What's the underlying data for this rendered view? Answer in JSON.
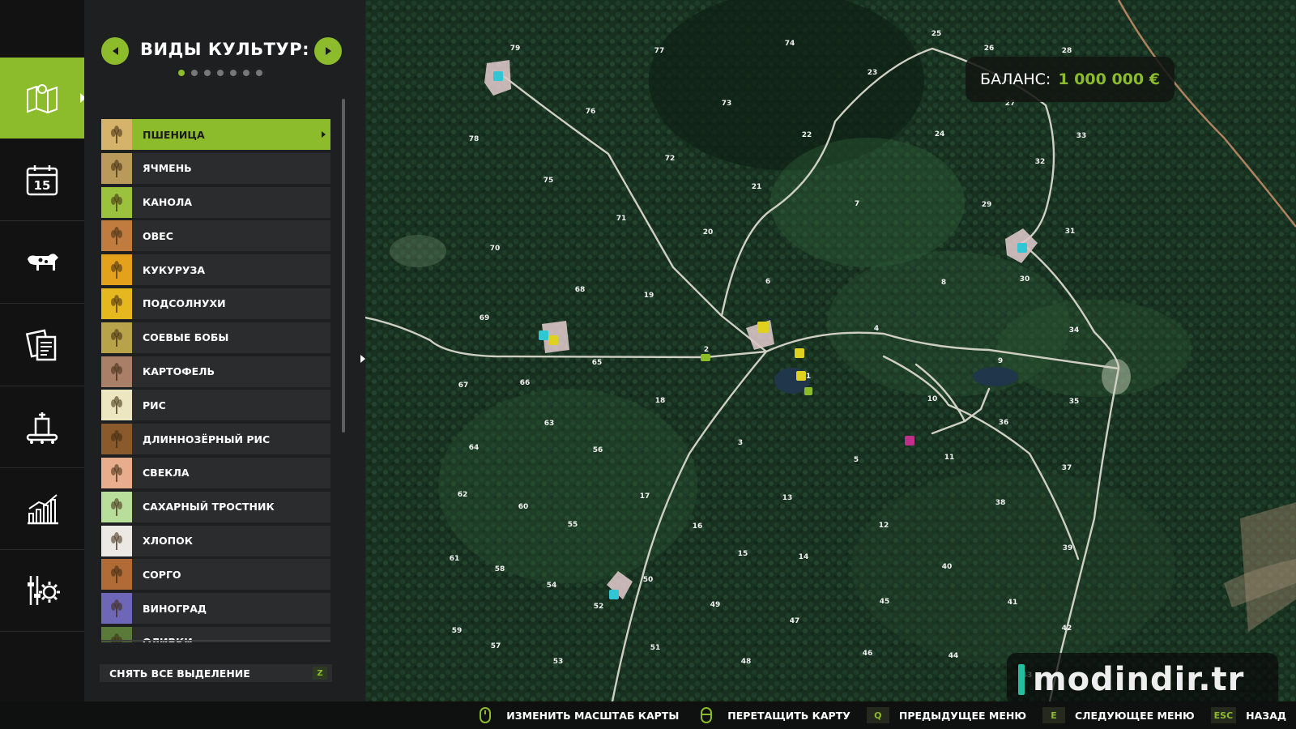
{
  "nav": {
    "items": [
      {
        "name": "map",
        "icon": "map-icon",
        "active": true
      },
      {
        "name": "calendar",
        "icon": "calendar-icon",
        "active": false,
        "day": "15"
      },
      {
        "name": "animals",
        "icon": "cow-icon",
        "active": false
      },
      {
        "name": "contracts",
        "icon": "documents-icon",
        "active": false
      },
      {
        "name": "production",
        "icon": "factory-icon",
        "active": false
      },
      {
        "name": "statistics",
        "icon": "chart-icon",
        "active": false
      },
      {
        "name": "settings",
        "icon": "gear-icon",
        "active": false
      }
    ]
  },
  "panel": {
    "title": "ВИДЫ КУЛЬТУР:",
    "page_count": 7,
    "current_page": 1,
    "crops": [
      {
        "label": "ПШЕНИЦА",
        "color": "#d6b36a",
        "selected": true
      },
      {
        "label": "ЯЧМЕНЬ",
        "color": "#b99a5b"
      },
      {
        "label": "КАНОЛА",
        "color": "#9bc23c"
      },
      {
        "label": "ОВЕС",
        "color": "#c07c3f"
      },
      {
        "label": "КУКУРУЗА",
        "color": "#e4a21c"
      },
      {
        "label": "ПОДСОЛНУХИ",
        "color": "#e6b81f"
      },
      {
        "label": "СОЕВЫЕ БОБЫ",
        "color": "#b8a24a"
      },
      {
        "label": "КАРТОФЕЛЬ",
        "color": "#a98067"
      },
      {
        "label": "РИС",
        "color": "#ece7c0"
      },
      {
        "label": "ДЛИННОЗЁРНЫЙ РИС",
        "color": "#8a5a2c"
      },
      {
        "label": "СВЕКЛА",
        "color": "#e7ad8c"
      },
      {
        "label": "САХАРНЫЙ ТРОСТНИК",
        "color": "#b9dd9b"
      },
      {
        "label": "ХЛОПОК",
        "color": "#ece9e4"
      },
      {
        "label": "СОРГО",
        "color": "#b06b36"
      },
      {
        "label": "ВИНОГРАД",
        "color": "#6e66b6"
      },
      {
        "label": "ОЛИВКИ",
        "color": "#5a7a3a"
      }
    ],
    "clear_label": "СНЯТЬ ВСЕ ВЫДЕЛЕНИЕ",
    "clear_key": "Z"
  },
  "balance": {
    "label": "БАЛАНС:",
    "value": "1 000 000 €"
  },
  "watermark": "modindir.tr",
  "map": {
    "field_numbers": [
      {
        "n": "79"
      },
      {
        "n": "77"
      },
      {
        "n": "74"
      },
      {
        "n": "25"
      },
      {
        "n": "26"
      },
      {
        "n": "28"
      },
      {
        "n": "23"
      },
      {
        "n": "27"
      },
      {
        "n": "76"
      },
      {
        "n": "73"
      },
      {
        "n": "78"
      },
      {
        "n": "72"
      },
      {
        "n": "22"
      },
      {
        "n": "24"
      },
      {
        "n": "33"
      },
      {
        "n": "32"
      },
      {
        "n": "75"
      },
      {
        "n": "21"
      },
      {
        "n": "7"
      },
      {
        "n": "29"
      },
      {
        "n": "71"
      },
      {
        "n": "20"
      },
      {
        "n": "31"
      },
      {
        "n": "70"
      },
      {
        "n": "6"
      },
      {
        "n": "8"
      },
      {
        "n": "30"
      },
      {
        "n": "68"
      },
      {
        "n": "19"
      },
      {
        "n": "69"
      },
      {
        "n": "4"
      },
      {
        "n": "34"
      },
      {
        "n": "2"
      },
      {
        "n": "9"
      },
      {
        "n": "65"
      },
      {
        "n": "1"
      },
      {
        "n": "67"
      },
      {
        "n": "66"
      },
      {
        "n": "18"
      },
      {
        "n": "10"
      },
      {
        "n": "35"
      },
      {
        "n": "63"
      },
      {
        "n": "36"
      },
      {
        "n": "3"
      },
      {
        "n": "64"
      },
      {
        "n": "56"
      },
      {
        "n": "5"
      },
      {
        "n": "11"
      },
      {
        "n": "37"
      },
      {
        "n": "62"
      },
      {
        "n": "17"
      },
      {
        "n": "13"
      },
      {
        "n": "38"
      },
      {
        "n": "60"
      },
      {
        "n": "55"
      },
      {
        "n": "16"
      },
      {
        "n": "12"
      },
      {
        "n": "15"
      },
      {
        "n": "14"
      },
      {
        "n": "39"
      },
      {
        "n": "61"
      },
      {
        "n": "58"
      },
      {
        "n": "54"
      },
      {
        "n": "50"
      },
      {
        "n": "40"
      },
      {
        "n": "52"
      },
      {
        "n": "49"
      },
      {
        "n": "45"
      },
      {
        "n": "41"
      },
      {
        "n": "59"
      },
      {
        "n": "47"
      },
      {
        "n": "42"
      },
      {
        "n": "57"
      },
      {
        "n": "51"
      },
      {
        "n": "46"
      },
      {
        "n": "44"
      },
      {
        "n": "53"
      },
      {
        "n": "48"
      },
      {
        "n": "43"
      }
    ]
  },
  "hints": [
    {
      "key": "",
      "icon": "mouse-icon",
      "label": "ИЗМЕНИТЬ МАСШТАБ КАРТЫ"
    },
    {
      "key": "",
      "icon": "mouse-icon",
      "label": "ПЕРЕТАЩИТЬ КАРТУ"
    },
    {
      "key": "Q",
      "label": "ПРЕДЫДУЩЕЕ МЕНЮ"
    },
    {
      "key": "E",
      "label": "СЛЕДУЮЩЕЕ МЕНЮ"
    },
    {
      "key": "ESC",
      "label": "НАЗАД"
    }
  ],
  "colors": {
    "accent": "#8cbc2c",
    "panel": "#1d1f20",
    "row": "#2a2c2d"
  }
}
